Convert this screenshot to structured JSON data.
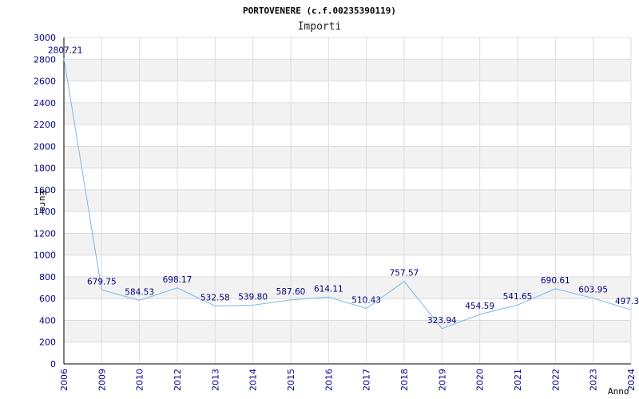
{
  "chart_data": {
    "type": "line",
    "title": "PORTOVENERE (c.f.00235390119)",
    "subtitle": "Importi",
    "xlabel": "Anno",
    "ylabel": "Euro",
    "categories": [
      "2006",
      "2009",
      "2010",
      "2012",
      "2013",
      "2014",
      "2015",
      "2016",
      "2017",
      "2018",
      "2019",
      "2020",
      "2021",
      "2022",
      "2023",
      "2024"
    ],
    "series": [
      {
        "values": [
          2807.21,
          679.75,
          584.53,
          698.17,
          532.58,
          539.8,
          587.6,
          614.11,
          510.43,
          757.57,
          323.94,
          454.59,
          541.65,
          690.61,
          603.95,
          497.3
        ],
        "labels": [
          "2807.21",
          "679.75",
          "584.53",
          "698.17",
          "532.58",
          "539.80",
          "587.60",
          "614.11",
          "510.43",
          "757.57",
          "323.94",
          "454.59",
          "541.65",
          "690.61",
          "603.95",
          "497.3"
        ]
      }
    ],
    "ylim": [
      0,
      3000
    ],
    "yticks": [
      "0",
      "200",
      "400",
      "600",
      "800",
      "1000",
      "1200",
      "1400",
      "1600",
      "1800",
      "2000",
      "2200",
      "2400",
      "2600",
      "2800",
      "3000"
    ],
    "grid": true,
    "colors": {
      "line": "#7eb6e9",
      "band": "#f2f2f2",
      "grid": "#dcdcdc",
      "axis": "#000000",
      "tick_text": "#00008b",
      "label_text": "#000080"
    }
  }
}
